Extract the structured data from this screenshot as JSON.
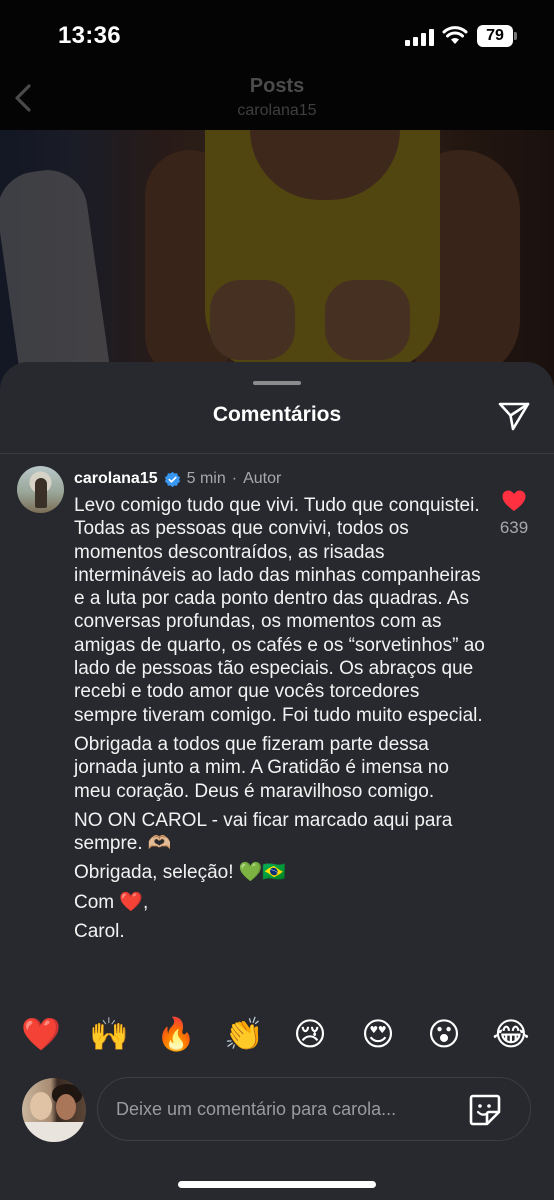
{
  "status_bar": {
    "time": "13:36",
    "battery": "79"
  },
  "nav": {
    "title": "Posts",
    "subtitle": "carolana15"
  },
  "sheet": {
    "title": "Comentários"
  },
  "comment": {
    "username": "carolana15",
    "time": "5 min",
    "separator": "·",
    "author_label": "Autor",
    "paragraphs": [
      "Levo comigo tudo que vivi. Tudo que conquistei. Todas as pessoas que convivi, todos os momentos descontraídos, as risadas intermináveis ao lado das minhas companheiras e a luta por cada ponto dentro das quadras. As conversas profundas, os momentos com as amigas de quarto, os cafés e os “sorvetinhos” ao lado de pessoas tão especiais. Os abraços que recebi e todo amor que vocês torcedores sempre tiveram comigo. Foi tudo muito especial.",
      "Obrigada a todos que fizeram parte dessa jornada junto a mim. A Gratidão é imensa no meu coração. Deus é maravilhoso comigo.",
      "NO ON CAROL - vai ficar marcado aqui para sempre. 🫶🏼",
      "Obrigada, seleção! 💚🇧🇷",
      "Com ❤️,",
      "Carol."
    ],
    "like_count": "639"
  },
  "reactions": [
    "❤️",
    "🙌",
    "🔥",
    "👏",
    "😢",
    "😍",
    "😮",
    "😂"
  ],
  "composer": {
    "placeholder": "Deixe um comentário para carola..."
  },
  "icons": {
    "back": "chevron-left-icon",
    "share": "paper-plane-icon",
    "verified": "verified-badge-icon",
    "like": "heart-icon",
    "sticker": "sticker-icon"
  },
  "colors": {
    "sheet_bg": "#27292e",
    "verified": "#3897f0",
    "like": "#ff3040"
  }
}
